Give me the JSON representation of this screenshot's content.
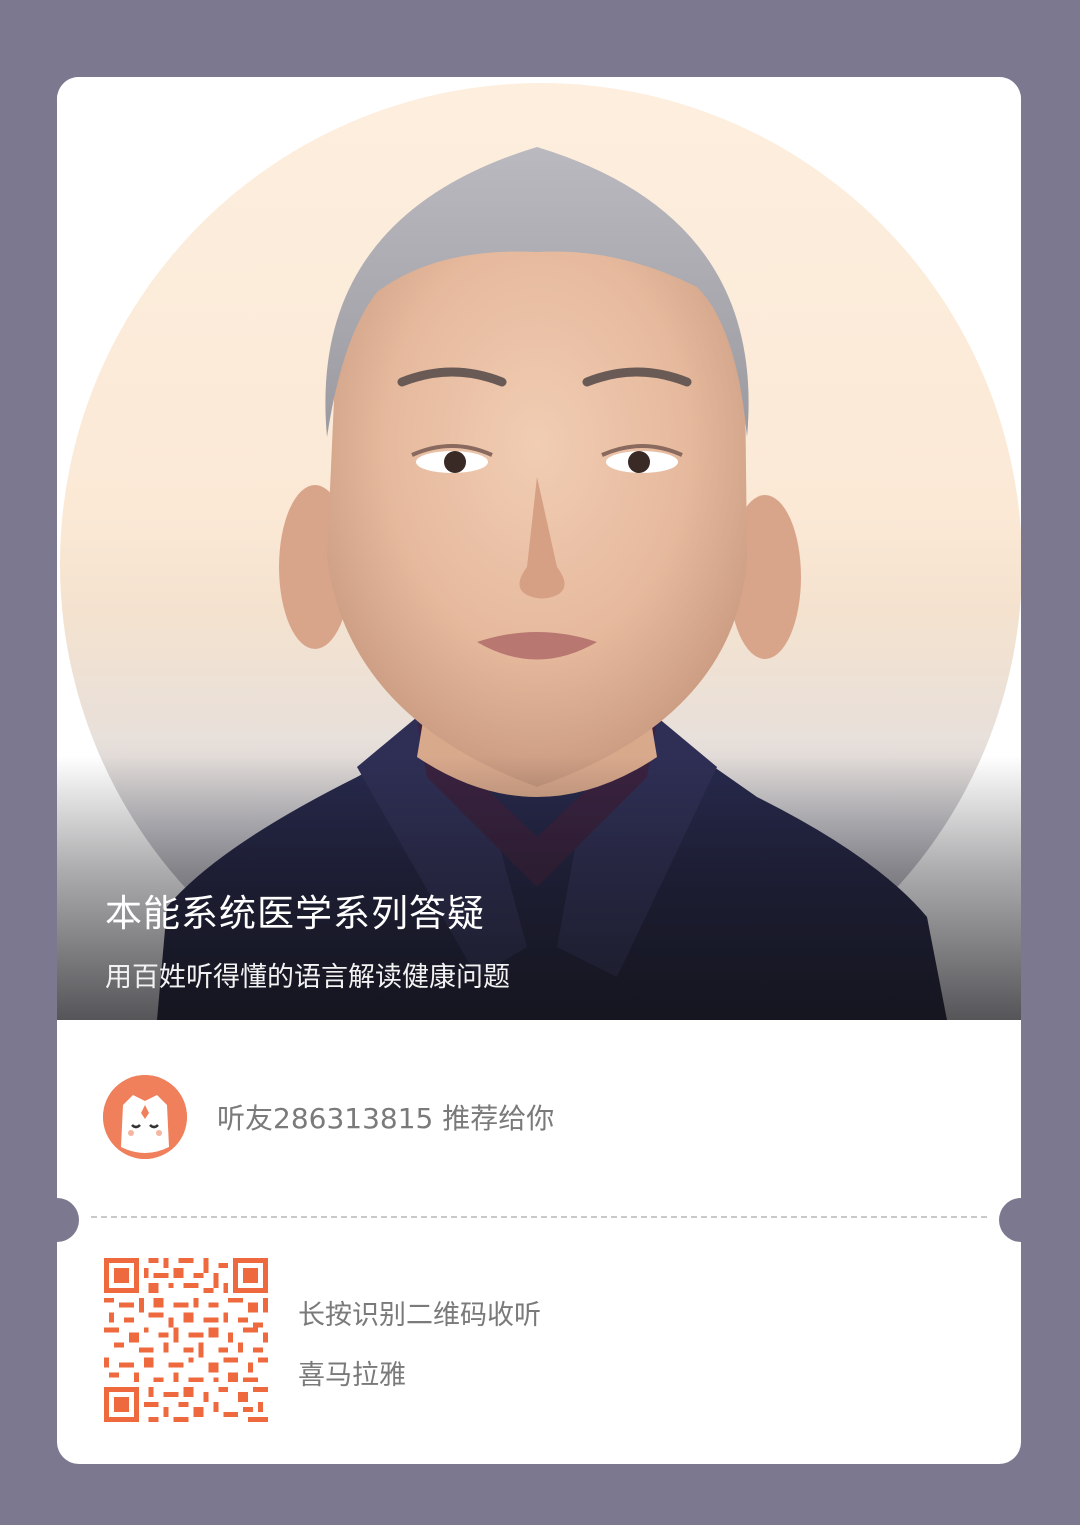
{
  "colors": {
    "background": "#7b788f",
    "card": "#ffffff",
    "accent": "#f07f5c",
    "qr": "#ee6a3e",
    "muted_text": "#7a7a7a"
  },
  "hero": {
    "title": "本能系统医学系列答疑",
    "subtitle": "用百姓听得懂的语言解读健康问题",
    "image": "portrait-photo"
  },
  "recommendation": {
    "avatar_icon": "ximalaya-cat-icon",
    "text": "听友286313815 推荐给你"
  },
  "qr_section": {
    "code_icon": "qr-code-icon",
    "hint": "长按识别二维码收听",
    "brand": "喜马拉雅"
  }
}
